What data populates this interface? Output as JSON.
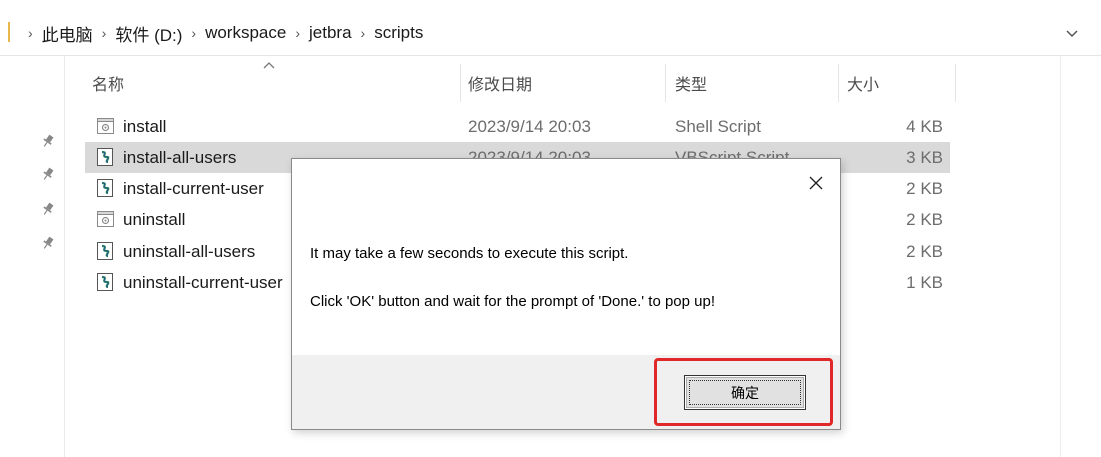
{
  "address_bar": {
    "breadcrumbs": [
      "此电脑",
      "软件 (D:)",
      "workspace",
      "jetbra",
      "scripts"
    ],
    "separator": "›"
  },
  "columns": {
    "name": "名称",
    "date": "修改日期",
    "type": "类型",
    "size": "大小"
  },
  "files": [
    {
      "name": "install",
      "date": "2023/9/14 20:03",
      "type": "Shell Script",
      "size": "4 KB",
      "icon": "shell-script-icon"
    },
    {
      "name": "install-all-users",
      "date": "2023/9/14 20:03",
      "type": "VBScript Script",
      "size": "3 KB",
      "icon": "vbscript-icon",
      "selected": true
    },
    {
      "name": "install-current-user",
      "date": "",
      "type": "",
      "size": "2 KB",
      "icon": "vbscript-icon"
    },
    {
      "name": "uninstall",
      "date": "",
      "type": "",
      "size": "2 KB",
      "icon": "shell-script-icon"
    },
    {
      "name": "uninstall-all-users",
      "date": "",
      "type": "",
      "size": "2 KB",
      "icon": "vbscript-icon"
    },
    {
      "name": "uninstall-current-user",
      "date": "",
      "type": "",
      "size": "1 KB",
      "icon": "vbscript-icon"
    }
  ],
  "dialog": {
    "message_line1": "It may take a few seconds to execute this script.",
    "message_line2": "Click 'OK' button and wait for the prompt of 'Done.' to pop up!",
    "ok_label": "确定"
  },
  "colors": {
    "selection": "#d9d9d9",
    "highlight_box": "#e02828",
    "dialog_footer": "#f0f0f0"
  }
}
